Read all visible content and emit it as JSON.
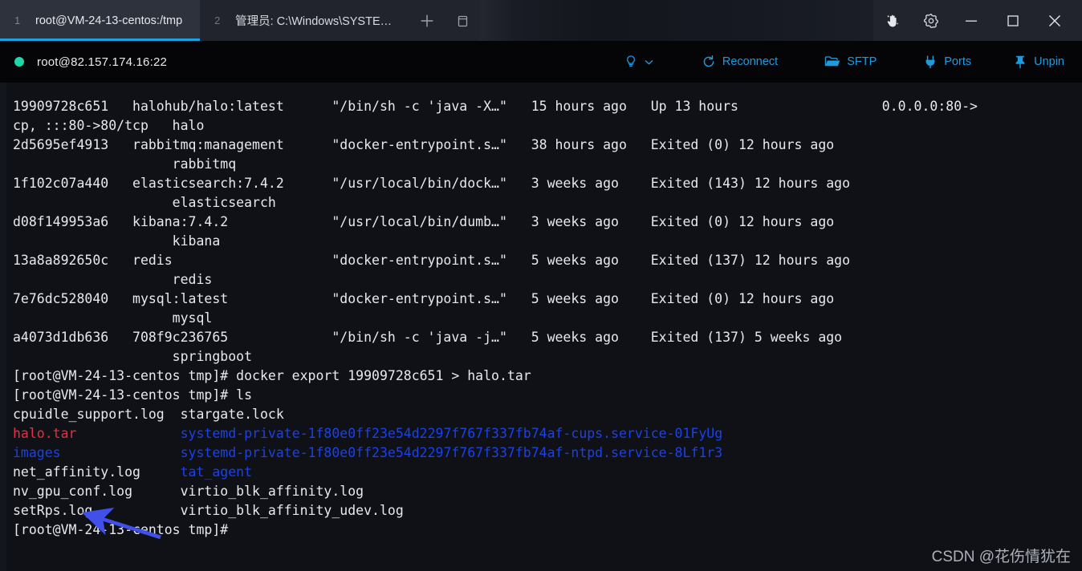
{
  "window": {
    "tabs": [
      {
        "num": "1",
        "title": "root@VM-24-13-centos:/tmp",
        "active": true
      },
      {
        "num": "2",
        "title": "管理员: C:\\Windows\\SYSTE…",
        "active": false
      }
    ],
    "new_tab_label": "+",
    "panes_label": "panes",
    "controls": {
      "hand": "magic-hand",
      "settings": "settings",
      "minimize": "minimize",
      "maximize": "maximize",
      "close": "close"
    },
    "accent": "#1ba1e2"
  },
  "toolbar": {
    "status_color": "#21d7a7",
    "connection": "root@82.157.174.16:22",
    "actions": [
      {
        "key": "tips",
        "label": "",
        "icon": "lightbulb-icon"
      },
      {
        "key": "reconnect",
        "label": "Reconnect",
        "icon": "refresh-icon"
      },
      {
        "key": "sftp",
        "label": "SFTP",
        "icon": "folder-icon"
      },
      {
        "key": "ports",
        "label": "Ports",
        "icon": "plug-icon"
      },
      {
        "key": "unpin",
        "label": "Unpin",
        "icon": "pin-icon"
      }
    ],
    "link_color": "#1e9ae0"
  },
  "terminal": {
    "background": "#0f1117",
    "foreground": "#e7e9ed",
    "colors": {
      "red": "#ef2b3f",
      "blue": "#1b41e8"
    },
    "lines": [
      {
        "segments": [
          {
            "t": "19909728c651   halohub/halo:latest      \"/bin/sh -c 'java -X…\"   15 hours ago   Up 13 hours                  0.0.0.0:80->",
            "c": "def"
          }
        ]
      },
      {
        "segments": [
          {
            "t": "cp, :::80->80/tcp   halo",
            "c": "def"
          }
        ]
      },
      {
        "segments": [
          {
            "t": "2d5695ef4913   rabbitmq:management      \"docker-entrypoint.s…\"   38 hours ago   Exited (0) 12 hours ago",
            "c": "def"
          }
        ]
      },
      {
        "segments": [
          {
            "t": "                    rabbitmq",
            "c": "def"
          }
        ]
      },
      {
        "segments": [
          {
            "t": "1f102c07a440   elasticsearch:7.4.2      \"/usr/local/bin/dock…\"   3 weeks ago    Exited (143) 12 hours ago",
            "c": "def"
          }
        ]
      },
      {
        "segments": [
          {
            "t": "                    elasticsearch",
            "c": "def"
          }
        ]
      },
      {
        "segments": [
          {
            "t": "d08f149953a6   kibana:7.4.2             \"/usr/local/bin/dumb…\"   3 weeks ago    Exited (0) 12 hours ago",
            "c": "def"
          }
        ]
      },
      {
        "segments": [
          {
            "t": "                    kibana",
            "c": "def"
          }
        ]
      },
      {
        "segments": [
          {
            "t": "13a8a892650c   redis                    \"docker-entrypoint.s…\"   5 weeks ago    Exited (137) 12 hours ago",
            "c": "def"
          }
        ]
      },
      {
        "segments": [
          {
            "t": "                    redis",
            "c": "def"
          }
        ]
      },
      {
        "segments": [
          {
            "t": "7e76dc528040   mysql:latest             \"docker-entrypoint.s…\"   5 weeks ago    Exited (0) 12 hours ago",
            "c": "def"
          }
        ]
      },
      {
        "segments": [
          {
            "t": "                    mysql",
            "c": "def"
          }
        ]
      },
      {
        "segments": [
          {
            "t": "a4073d1db636   708f9c236765             \"/bin/sh -c 'java -j…\"   5 weeks ago    Exited (137) 5 weeks ago",
            "c": "def"
          }
        ]
      },
      {
        "segments": [
          {
            "t": "                    springboot",
            "c": "def"
          }
        ]
      },
      {
        "segments": [
          {
            "t": "[root@VM-24-13-centos tmp]# docker export 19909728c651 > halo.tar",
            "c": "def"
          }
        ]
      },
      {
        "segments": [
          {
            "t": "[root@VM-24-13-centos tmp]# ls",
            "c": "def"
          }
        ]
      },
      {
        "segments": [
          {
            "t": "cpuidle_support.log  stargate.lock",
            "c": "def"
          }
        ]
      },
      {
        "segments": [
          {
            "t": "halo.tar",
            "c": "red"
          },
          {
            "t": "             ",
            "c": "def"
          },
          {
            "t": "systemd-private-1f80e0ff23e54d2297f767f337fb74af-cups.service-01FyUg",
            "c": "blue"
          }
        ]
      },
      {
        "segments": [
          {
            "t": "images",
            "c": "blue"
          },
          {
            "t": "               ",
            "c": "def"
          },
          {
            "t": "systemd-private-1f80e0ff23e54d2297f767f337fb74af-ntpd.service-8Lf1r3",
            "c": "blue"
          }
        ]
      },
      {
        "segments": [
          {
            "t": "net_affinity.log     ",
            "c": "def"
          },
          {
            "t": "tat_agent",
            "c": "blue"
          }
        ]
      },
      {
        "segments": [
          {
            "t": "nv_gpu_conf.log      virtio_blk_affinity.log",
            "c": "def"
          }
        ]
      },
      {
        "segments": [
          {
            "t": "setRps.log           virtio_blk_affinity_udev.log",
            "c": "def"
          }
        ]
      },
      {
        "segments": [
          {
            "t": "[root@VM-24-13-centos tmp]#",
            "c": "def"
          }
        ]
      }
    ]
  },
  "annotation": {
    "arrow_color": "#4050e8",
    "points_to": "halo.tar"
  },
  "watermark": {
    "text": "CSDN @花伤情犹在"
  }
}
